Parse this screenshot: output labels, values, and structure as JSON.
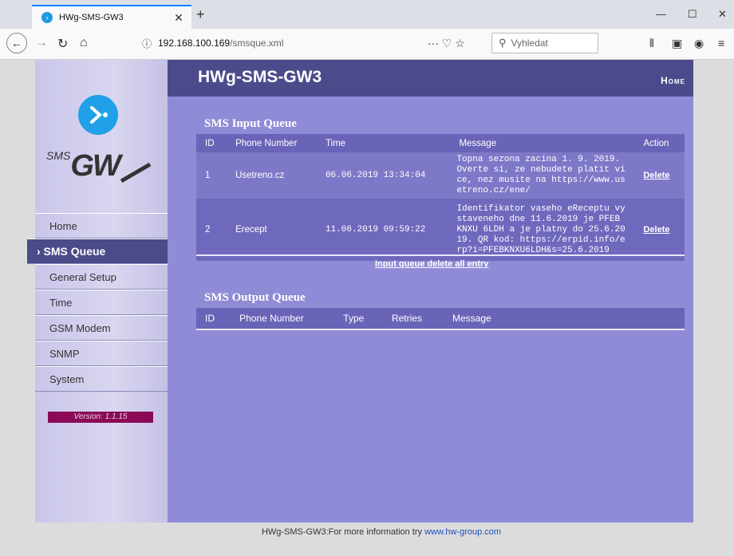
{
  "browser": {
    "tab_title": "HWg-SMS-GW3",
    "url_host": "192.168.100.169",
    "url_path": "/smsque.xml",
    "search_placeholder": "Vyhledat"
  },
  "header": {
    "title": "HWg-SMS-GW3",
    "home_link": "Home"
  },
  "logo": {
    "sms": "SMS",
    "gw": "GW"
  },
  "menu": {
    "items": [
      "Home",
      "› SMS Queue",
      "General Setup",
      "Time",
      "GSM Modem",
      "SNMP",
      "System"
    ]
  },
  "version": "Version: 1.1.15",
  "input_queue": {
    "title": "SMS Input Queue",
    "columns": [
      "ID",
      "Phone Number",
      "Time",
      "Message",
      "Action"
    ],
    "rows": [
      {
        "id": "1",
        "phone": "Usetreno.cz",
        "time": "06.06.2019 13:34:04",
        "message": "Topna sezona zacina 1. 9. 2019. Overte si, ze nebudete platit vice, nez musite na https://www.usetreno.cz/ene/",
        "action": "Delete"
      },
      {
        "id": "2",
        "phone": "Erecept",
        "time": "11.06.2019 09:59:22",
        "message": "Identifikator vaseho eReceptu vystaveneho dne 11.6.2019 je PFEB KNXU 6LDH a je platny do 25.6.2019. QR kod: https://erpid.info/erp?i=PFEBKNXU6LDH&s=25.6.2019",
        "action": "Delete"
      }
    ],
    "delete_all": "Input queue delete all entry"
  },
  "output_queue": {
    "title": "SMS Output Queue",
    "columns": [
      "ID",
      "Phone Number",
      "Type",
      "Retries",
      "Message"
    ]
  },
  "footer": {
    "text": "HWg-SMS-GW3:For more information try ",
    "link": "www.hw-group.com"
  }
}
